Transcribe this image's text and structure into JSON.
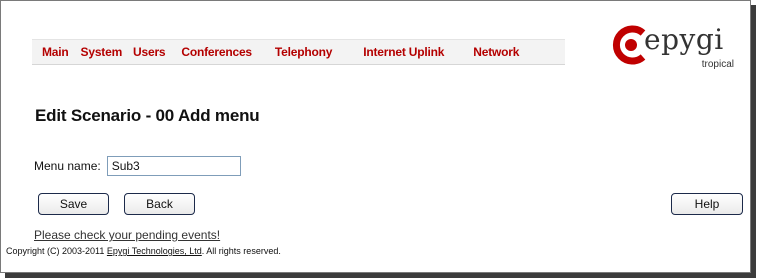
{
  "nav": {
    "items": [
      "Main",
      "System",
      "Users",
      "Conferences",
      "Telephony",
      "Internet Uplink",
      "Network"
    ]
  },
  "logo": {
    "text": "epygi",
    "sub": "tropical"
  },
  "page": {
    "title": "Edit Scenario - 00 Add menu"
  },
  "form": {
    "menu_name_label": "Menu name:",
    "menu_name_value": "Sub3"
  },
  "buttons": {
    "save": "Save",
    "back": "Back",
    "help": "Help"
  },
  "pending_link": "Please check your pending events!",
  "footer": {
    "prefix": "Copyright (C) 2003-2011 ",
    "company": "Epygi Technologies, Ltd",
    "suffix": ". All rights reserved."
  },
  "colors": {
    "nav_text": "#b40000",
    "logo_accent": "#c00000"
  }
}
